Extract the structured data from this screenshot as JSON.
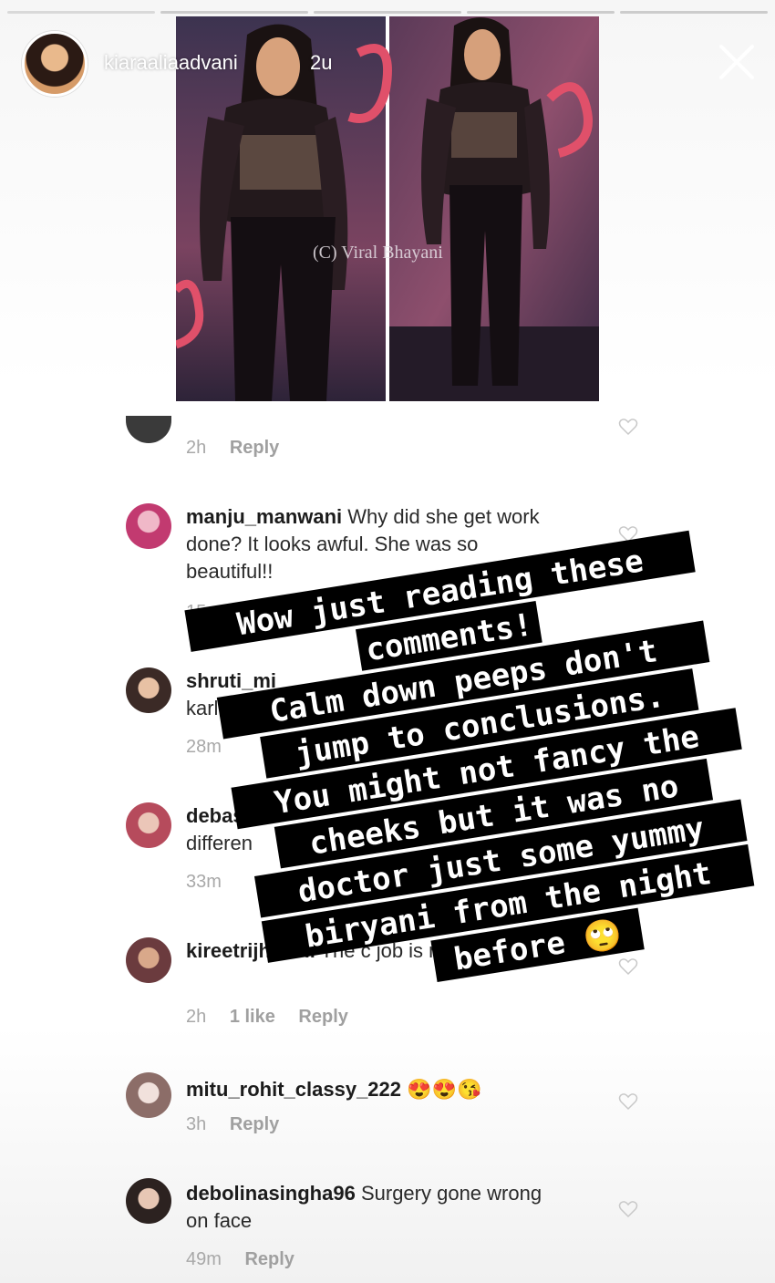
{
  "story": {
    "username": "kiaraaliaadvani",
    "time": "2u",
    "watermark": "(C) Viral Bhayani"
  },
  "comments": [
    {
      "user": "",
      "text": "",
      "time": "2h",
      "likes": "",
      "reply": "Reply"
    },
    {
      "user": "manju_manwani",
      "text": "Why did she get work done? It looks awful. She was so beautiful!!",
      "time": "15",
      "likes": "",
      "reply": ""
    },
    {
      "user": "shruti_mi",
      "text": "karli",
      "time": "28m",
      "likes": "",
      "reply": ""
    },
    {
      "user": "debash",
      "text": "differen",
      "time": "33m",
      "likes": "",
      "reply": ""
    },
    {
      "user": "kireetrijhwani",
      "text": "The c job is not on point",
      "emoji": "🤦",
      "time": "2h",
      "likes": "1 like",
      "reply": "Reply"
    },
    {
      "user": "mitu_rohit_classy_222",
      "text": "",
      "emoji": "😍😍😘",
      "time": "3h",
      "likes": "",
      "reply": "Reply"
    },
    {
      "user": "debolinasingha96",
      "text": "Surgery gone wrong on face",
      "time": "49m",
      "likes": "",
      "reply": "Reply"
    }
  ],
  "caption": {
    "lines": [
      "Wow just reading these",
      "comments!",
      "Calm down peeps don't",
      "jump to conclusions.",
      "You might not fancy the",
      "cheeks but it was no",
      "doctor just some yummy",
      "biryani from the night",
      "before 🙄"
    ]
  },
  "colors": {
    "caption_bg": "#000000",
    "caption_text": "#ffffff",
    "meta": "#a8a8a8"
  }
}
